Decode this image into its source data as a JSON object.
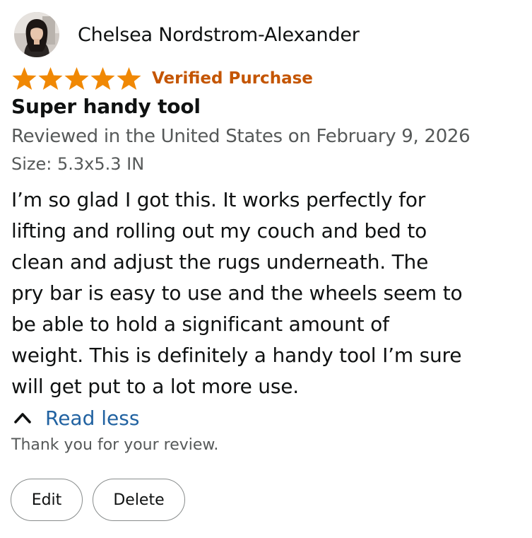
{
  "reviewer": {
    "name": "Chelsea Nordstrom-Alexander",
    "avatar_icon": "user-avatar"
  },
  "rating": {
    "stars": 5,
    "max_stars": 5,
    "star_color": "#f08804",
    "verified_label": "Verified Purchase",
    "verified_color": "#c45500"
  },
  "review": {
    "title": "Super handy tool",
    "date_line": "Reviewed in the United States on February 9, 2026",
    "variant": "Size: 5.3x5.3 IN",
    "body_lines": [
      "I’m so glad I got this. It works perfectly for",
      "lifting and rolling out my couch and bed to",
      "clean and adjust the rugs underneath. The",
      "pry bar is easy to use and the wheels seem to",
      "be able to hold a significant amount of",
      "weight. This is definitely a handy tool I’m sure",
      "will get put to a lot more use."
    ],
    "read_less_label": "Read less",
    "read_less_icon": "chevron-up-icon",
    "link_color": "#2162a1"
  },
  "thanks_text": "Thank you for your review.",
  "actions": {
    "edit_label": "Edit",
    "delete_label": "Delete"
  }
}
